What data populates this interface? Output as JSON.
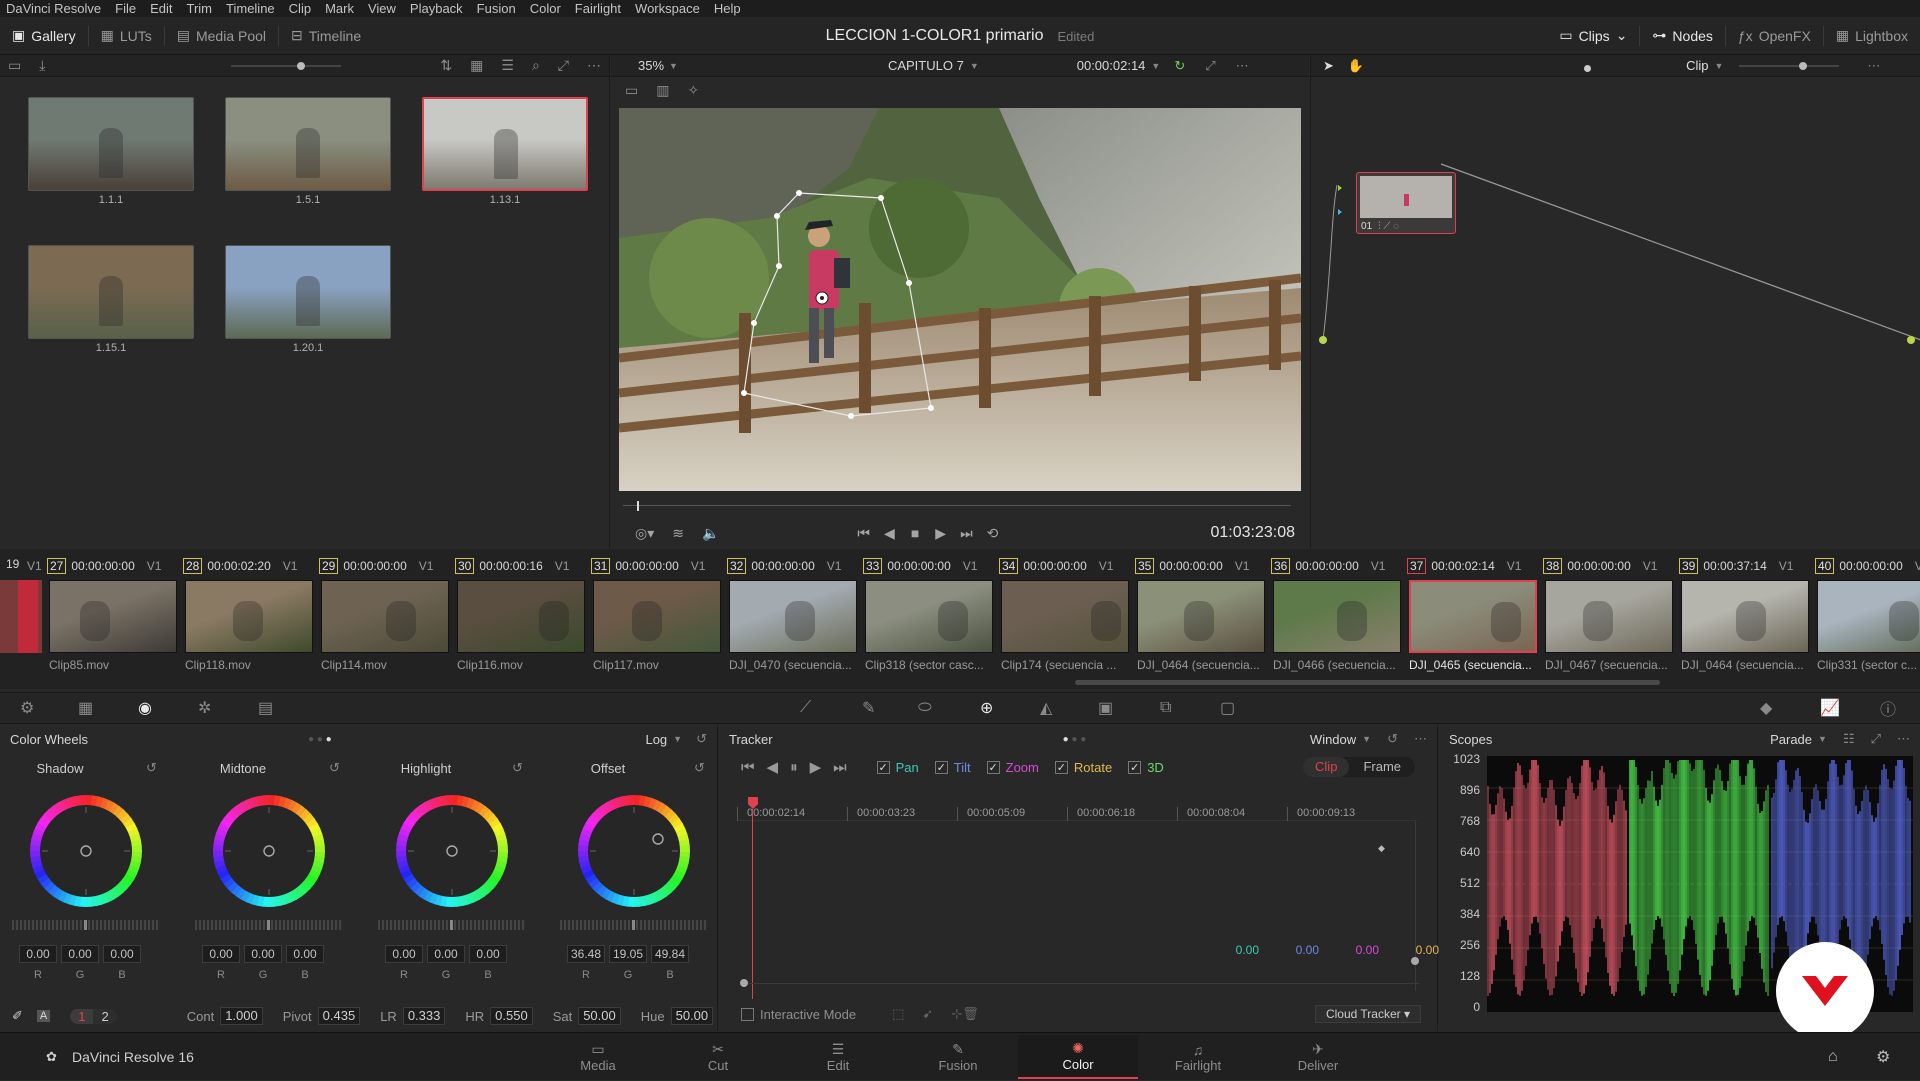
{
  "menu": [
    "DaVinci Resolve",
    "File",
    "Edit",
    "Trim",
    "Timeline",
    "Clip",
    "Mark",
    "View",
    "Playback",
    "Fusion",
    "Color",
    "Fairlight",
    "Workspace",
    "Help"
  ],
  "topbar": {
    "left": [
      {
        "label": "Gallery",
        "icon": "gallery-icon"
      },
      {
        "label": "LUTs",
        "icon": "luts-icon"
      },
      {
        "label": "Media Pool",
        "icon": "media-pool-icon"
      },
      {
        "label": "Timeline",
        "icon": "timeline-icon"
      }
    ],
    "title": "LECCION 1-COLOR1 primario",
    "status": "Edited",
    "right": [
      {
        "label": "Clips",
        "icon": "clips-icon"
      },
      {
        "label": "Nodes",
        "icon": "nodes-icon"
      },
      {
        "label": "OpenFX",
        "icon": "openfx-icon"
      },
      {
        "label": "Lightbox",
        "icon": "lightbox-icon"
      }
    ]
  },
  "gallery": {
    "stills": [
      {
        "label": "1.1.1",
        "sky": "#6f7a72",
        "ground": "#4a4038"
      },
      {
        "label": "1.5.1",
        "sky": "#8a8f80",
        "ground": "#6d5b44"
      },
      {
        "label": "1.13.1",
        "sky": "#c8c8c4",
        "ground": "#7d7a70",
        "selected": true
      },
      {
        "label": "1.15.1",
        "sky": "#7c6b52",
        "ground": "#58614a"
      },
      {
        "label": "1.20.1",
        "sky": "#8aa2c2",
        "ground": "#5d6a55"
      }
    ]
  },
  "viewer": {
    "zoom": "35%",
    "timeline_name": "CAPITULO 7",
    "timecode": "00:00:02:14",
    "playhead_tc": "01:03:23:08"
  },
  "nodes": {
    "mode": "Clip",
    "node_label": "01"
  },
  "timeline": {
    "partial_left": "19",
    "clips": [
      {
        "num": "27",
        "tc": "00:00:00:00",
        "name": "Clip85.mov",
        "c1": "#7a7266",
        "c2": "#3d3a35"
      },
      {
        "num": "28",
        "tc": "00:00:02:20",
        "name": "Clip118.mov",
        "c1": "#8b7a63",
        "c2": "#3e4a2c"
      },
      {
        "num": "29",
        "tc": "00:00:00:00",
        "name": "Clip114.mov",
        "c1": "#6e6352",
        "c2": "#4a4a36"
      },
      {
        "num": "30",
        "tc": "00:00:00:16",
        "name": "Clip116.mov",
        "c1": "#5a4e40",
        "c2": "#3a4a2c"
      },
      {
        "num": "31",
        "tc": "00:00:00:00",
        "name": "Clip117.mov",
        "c1": "#6d5a48",
        "c2": "#44573a"
      },
      {
        "num": "32",
        "tc": "00:00:00:00",
        "name": "DJI_0470 (secuencia...",
        "c1": "#a3aab0",
        "c2": "#6a6d58"
      },
      {
        "num": "33",
        "tc": "00:00:00:00",
        "name": "Clip318 (sector casc...",
        "c1": "#8b8e80",
        "c2": "#4b5240"
      },
      {
        "num": "34",
        "tc": "00:00:00:00",
        "name": "Clip174 (secuencia ...",
        "c1": "#6c5f52",
        "c2": "#55523c"
      },
      {
        "num": "35",
        "tc": "00:00:00:00",
        "name": "DJI_0464 (secuencia...",
        "c1": "#8b9078",
        "c2": "#5a5040"
      },
      {
        "num": "36",
        "tc": "00:00:00:00",
        "name": "DJI_0466 (secuencia...",
        "c1": "#5f7a4a",
        "c2": "#8a7f6e"
      },
      {
        "num": "37",
        "tc": "00:00:02:14",
        "name": "DJI_0465 (secuencia...",
        "c1": "#8b8c7a",
        "c2": "#7a6552",
        "selected": true
      },
      {
        "num": "38",
        "tc": "00:00:00:00",
        "name": "DJI_0467 (secuencia...",
        "c1": "#a7a69e",
        "c2": "#6e6a5a"
      },
      {
        "num": "39",
        "tc": "00:00:37:14",
        "name": "DJI_0464 (secuencia...",
        "c1": "#b5b5ae",
        "c2": "#6a6454"
      },
      {
        "num": "40",
        "tc": "00:00:00:00",
        "name": "Clip331 (sector c...",
        "c1": "#a9b4bf",
        "c2": "#5b6650"
      }
    ],
    "track": "V1"
  },
  "color_wheels": {
    "title": "Color Wheels",
    "mode": "Log",
    "wheels": [
      {
        "label": "Shadow",
        "r": "0.00",
        "g": "0.00",
        "b": "0.00"
      },
      {
        "label": "Midtone",
        "r": "0.00",
        "g": "0.00",
        "b": "0.00"
      },
      {
        "label": "Highlight",
        "r": "0.00",
        "g": "0.00",
        "b": "0.00"
      },
      {
        "label": "Offset",
        "r": "36.48",
        "g": "19.05",
        "b": "49.84"
      }
    ],
    "channel_labels": {
      "r": "R",
      "g": "G",
      "b": "B"
    },
    "pages": [
      "1",
      "2"
    ],
    "params": [
      {
        "label": "Cont",
        "value": "1.000"
      },
      {
        "label": "Pivot",
        "value": "0.435"
      },
      {
        "label": "LR",
        "value": "0.333"
      },
      {
        "label": "HR",
        "value": "0.550"
      },
      {
        "label": "Sat",
        "value": "50.00"
      },
      {
        "label": "Hue",
        "value": "50.00"
      }
    ]
  },
  "tracker": {
    "title": "Tracker",
    "mode": "Window",
    "options": [
      {
        "label": "Pan",
        "color": "#3dc9b4"
      },
      {
        "label": "Tilt",
        "color": "#6f8ae0"
      },
      {
        "label": "Zoom",
        "color": "#d84ad8"
      },
      {
        "label": "Rotate",
        "color": "#e0b850"
      },
      {
        "label": "3D",
        "color": "#6ad86a"
      }
    ],
    "clip_btn": "Clip",
    "frame_btn": "Frame",
    "ruler": [
      "00:00:02:14",
      "00:00:03:23",
      "00:00:05:09",
      "00:00:06:18",
      "00:00:08:04",
      "00:00:09:13"
    ],
    "values": [
      {
        "v": "0.00",
        "color": "#3dc9b4"
      },
      {
        "v": "0.00",
        "color": "#6f8ae0"
      },
      {
        "v": "0.00",
        "color": "#d84ad8"
      },
      {
        "v": "0.00",
        "color": "#e0b850"
      }
    ],
    "interactive_mode": "Interactive Mode",
    "cloud_tracker": "Cloud Tracker"
  },
  "scopes": {
    "title": "Scopes",
    "mode": "Parade",
    "scale": [
      "1023",
      "896",
      "768",
      "640",
      "512",
      "384",
      "256",
      "128",
      "0"
    ]
  },
  "bottom": {
    "app": "DaVinci Resolve 16",
    "pages": [
      {
        "label": "Media",
        "icon": "media-page-icon"
      },
      {
        "label": "Cut",
        "icon": "cut-page-icon"
      },
      {
        "label": "Edit",
        "icon": "edit-page-icon"
      },
      {
        "label": "Fusion",
        "icon": "fusion-page-icon"
      },
      {
        "label": "Color",
        "icon": "color-page-icon",
        "active": true
      },
      {
        "label": "Fairlight",
        "icon": "fairlight-page-icon"
      },
      {
        "label": "Deliver",
        "icon": "deliver-page-icon"
      }
    ]
  },
  "colors": {
    "accent": "#e0414e",
    "panel": "#282828"
  }
}
